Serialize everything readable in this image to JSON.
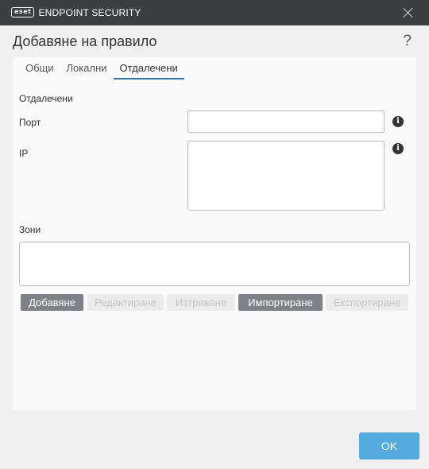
{
  "titlebar": {
    "logo_mark": "eset",
    "product_name": "ENDPOINT SECURITY",
    "close_icon": "close-icon"
  },
  "header": {
    "title": "Добавяне на правило",
    "help_symbol": "?"
  },
  "tabs": [
    {
      "label": "Общи",
      "active": false
    },
    {
      "label": "Локални",
      "active": false
    },
    {
      "label": "Отдалечени",
      "active": true
    }
  ],
  "remote": {
    "section_label": "Отдалечени",
    "port_label": "Порт",
    "port_value": "",
    "ip_label": "IP",
    "ip_value": "",
    "info_symbol": "i"
  },
  "zones": {
    "label": "Зони",
    "items": []
  },
  "zone_buttons": [
    {
      "label": "Добавяне",
      "enabled": true
    },
    {
      "label": "Редактиране",
      "enabled": false
    },
    {
      "label": "Изтриване",
      "enabled": false
    },
    {
      "label": "Импортиране",
      "enabled": true
    },
    {
      "label": "Експортиране",
      "enabled": false
    }
  ],
  "footer": {
    "ok_label": "OK"
  },
  "colors": {
    "titlebar": "#3c3f41",
    "accent": "#52abdc",
    "tab_underline": "#2e78b0",
    "button_enabled": "#7e8286",
    "button_disabled": "#ececec"
  }
}
